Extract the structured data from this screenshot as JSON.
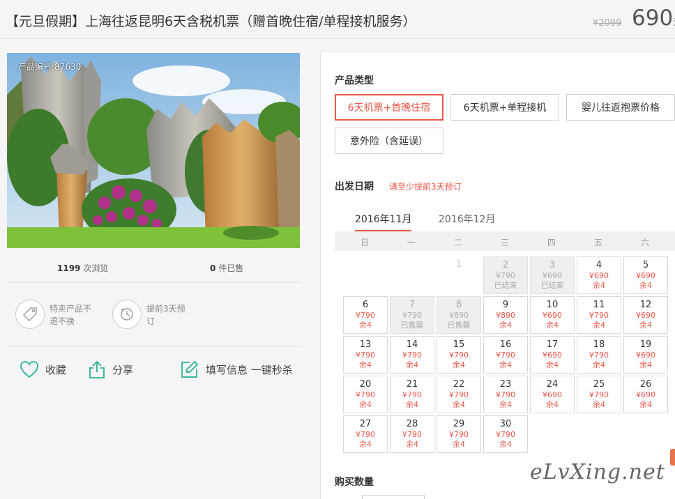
{
  "header": {
    "title": "【元旦假期】上海往返昆明6天含税机票（赠首晚住宿/单程接机服务）",
    "old_price": "¥2099",
    "price": "690",
    "price_unit": "元"
  },
  "product": {
    "id_label": "产品编号:87630",
    "views_count": "1199",
    "views_label": "次浏览",
    "sold_count": "0",
    "sold_label": "件已售"
  },
  "guarantees": [
    {
      "icon": "tag-icon",
      "line1": "特卖产品不",
      "line2": "退不换"
    },
    {
      "icon": "clock-icon",
      "line1": "提前3天预",
      "line2": "订"
    }
  ],
  "actions": {
    "favorite": "收藏",
    "share": "分享",
    "fill_info": "填写信息 一键秒杀"
  },
  "booking": {
    "type_label": "产品类型",
    "types": [
      "6天机票+首晚住宿",
      "6天机票+单程接机",
      "婴儿往返抱票价格",
      "意外险（含延误）"
    ],
    "active_type": 0,
    "date_label": "出发日期",
    "date_hint": "请至少提前3天预订",
    "months": [
      "2016年11月",
      "2016年12月"
    ],
    "active_month": 0,
    "weekdays": [
      "日",
      "一",
      "二",
      "三",
      "四",
      "五",
      "六"
    ],
    "quantity_label": "购买数量"
  },
  "calendar": [
    {
      "day": "1",
      "blank": true
    },
    {
      "day": "2",
      "price": "¥790",
      "status": "已结束",
      "disabled": true
    },
    {
      "day": "3",
      "price": "¥690",
      "status": "已结束",
      "disabled": true
    },
    {
      "day": "4",
      "price": "¥690",
      "status": "余4"
    },
    {
      "day": "5",
      "price": "¥690",
      "status": "余4"
    },
    {
      "day": "6",
      "price": "¥790",
      "status": "余4"
    },
    {
      "day": "7",
      "price": "¥790",
      "status": "已售罄",
      "disabled": true
    },
    {
      "day": "8",
      "price": "¥890",
      "status": "已售罄",
      "disabled": true
    },
    {
      "day": "9",
      "price": "¥890",
      "status": "余4"
    },
    {
      "day": "10",
      "price": "¥690",
      "status": "余4"
    },
    {
      "day": "11",
      "price": "¥790",
      "status": "余4"
    },
    {
      "day": "12",
      "price": "¥690",
      "status": "余4"
    },
    {
      "day": "13",
      "price": "¥790",
      "status": "余4"
    },
    {
      "day": "14",
      "price": "¥790",
      "status": "余4"
    },
    {
      "day": "15",
      "price": "¥790",
      "status": "余4"
    },
    {
      "day": "16",
      "price": "¥790",
      "status": "余4"
    },
    {
      "day": "17",
      "price": "¥690",
      "status": "余4"
    },
    {
      "day": "18",
      "price": "¥790",
      "status": "余4"
    },
    {
      "day": "19",
      "price": "¥690",
      "status": "余4"
    },
    {
      "day": "20",
      "price": "¥790",
      "status": "余4"
    },
    {
      "day": "21",
      "price": "¥790",
      "status": "余4"
    },
    {
      "day": "22",
      "price": "¥790",
      "status": "余4"
    },
    {
      "day": "23",
      "price": "¥790",
      "status": "余4"
    },
    {
      "day": "24",
      "price": "¥690",
      "status": "余4"
    },
    {
      "day": "25",
      "price": "¥790",
      "status": "余4"
    },
    {
      "day": "26",
      "price": "¥690",
      "status": "余4"
    },
    {
      "day": "27",
      "price": "¥790",
      "status": "余4"
    },
    {
      "day": "28",
      "price": "¥790",
      "status": "余4"
    },
    {
      "day": "29",
      "price": "¥790",
      "status": "余4"
    },
    {
      "day": "30",
      "price": "¥790",
      "status": "余4"
    }
  ],
  "watermark": "eLvXing.net",
  "colors": {
    "accent": "#e8574a",
    "icon_green": "#3bb89a"
  }
}
